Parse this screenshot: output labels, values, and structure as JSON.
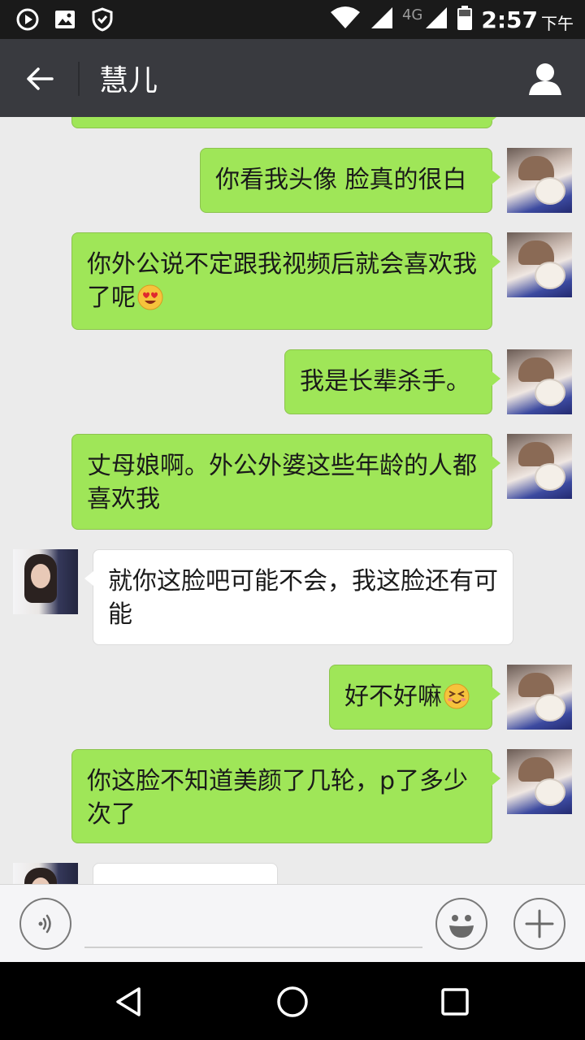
{
  "status_bar": {
    "network": "4G",
    "time": "2:57",
    "ampm": "下午",
    "icons": [
      "play-circle-icon",
      "image-icon",
      "shield-icon",
      "wifi-icon",
      "cell-signal-icon",
      "battery-icon"
    ]
  },
  "header": {
    "title": "慧儿",
    "back_icon": "arrow-left-icon",
    "profile_icon": "person-icon",
    "background": "#393a3f"
  },
  "messages": [
    {
      "from": "me",
      "text": ""
    },
    {
      "from": "me",
      "text": "你看我头像 脸真的很白"
    },
    {
      "from": "me",
      "text": "你外公说不定跟我视频后就会喜欢我了呢",
      "emoji": "heart-eyes-emoji"
    },
    {
      "from": "me",
      "text": "我是长辈杀手。"
    },
    {
      "from": "me",
      "text": "丈母娘啊。外公外婆这些年龄的人都喜欢我"
    },
    {
      "from": "her",
      "text": "就你这脸吧可能不会，我这脸还有可能"
    },
    {
      "from": "me",
      "text": "好不好嘛",
      "emoji": "squinting-smile-emoji"
    },
    {
      "from": "me",
      "text": "你这脸不知道美颜了几轮，p了多少次了"
    },
    {
      "from": "her",
      "text": ""
    }
  ],
  "input_bar": {
    "voice_icon": "voice-icon",
    "emoji_icon": "smiley-icon",
    "plus_icon": "plus-icon"
  },
  "nav_bar": {
    "icons": [
      "nav-back-icon",
      "nav-home-icon",
      "nav-recents-icon"
    ]
  },
  "colors": {
    "outgoing_bubble": "#9fe658",
    "incoming_bubble": "#ffffff",
    "chat_background": "#ebebeb"
  }
}
